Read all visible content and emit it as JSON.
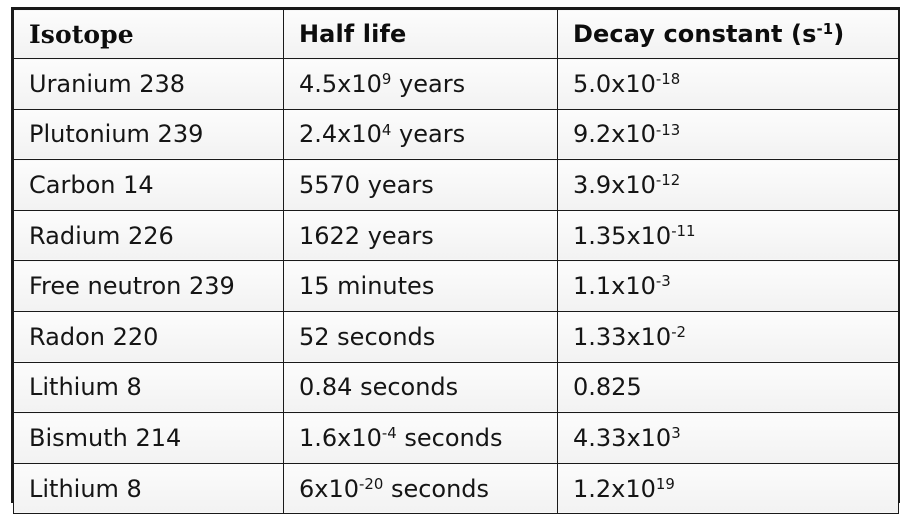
{
  "table": {
    "columns": [
      {
        "id": "isotope",
        "label": "Isotope"
      },
      {
        "id": "half_life",
        "label": "Half life"
      },
      {
        "id": "decay_constant",
        "label_base": "Decay constant (s",
        "label_sup": "-1",
        "label_tail": ")",
        "label_plain": "Decay constant (s-1)"
      }
    ],
    "rows": [
      {
        "isotope": "Uranium 238",
        "half_life": {
          "base": "4.5x10",
          "sup": "9",
          "tail": " years",
          "plain": "4.5x109 years"
        },
        "decay_constant": {
          "base": "5.0x10",
          "sup": "-18",
          "tail": "",
          "plain": "5.0x10-18"
        }
      },
      {
        "isotope": "Plutonium 239",
        "half_life": {
          "base": "2.4x10",
          "sup": "4",
          "tail": " years",
          "plain": "2.4x104 years"
        },
        "decay_constant": {
          "base": "9.2x10",
          "sup": "-13",
          "tail": "",
          "plain": "9.2x10-13"
        }
      },
      {
        "isotope": "Carbon 14",
        "half_life": {
          "base": "5570 years",
          "sup": "",
          "tail": "",
          "plain": "5570 years"
        },
        "decay_constant": {
          "base": "3.9x10",
          "sup": "-12",
          "tail": "",
          "plain": "3.9x10-12"
        }
      },
      {
        "isotope": "Radium 226",
        "half_life": {
          "base": "1622 years",
          "sup": "",
          "tail": "",
          "plain": "1622 years"
        },
        "decay_constant": {
          "base": "1.35x10",
          "sup": "-11",
          "tail": "",
          "plain": "1.35x10-11"
        }
      },
      {
        "isotope": "Free neutron 239",
        "half_life": {
          "base": "15 minutes",
          "sup": "",
          "tail": "",
          "plain": "15 minutes"
        },
        "decay_constant": {
          "base": "1.1x10",
          "sup": "-3",
          "tail": "",
          "plain": "1.1x10-3"
        }
      },
      {
        "isotope": "Radon 220",
        "half_life": {
          "base": "52 seconds",
          "sup": "",
          "tail": "",
          "plain": "52 seconds"
        },
        "decay_constant": {
          "base": "1.33x10",
          "sup": "-2",
          "tail": "",
          "plain": "1.33x10-2"
        }
      },
      {
        "isotope": "Lithium 8",
        "half_life": {
          "base": "0.84 seconds",
          "sup": "",
          "tail": "",
          "plain": "0.84 seconds"
        },
        "decay_constant": {
          "base": "0.825",
          "sup": "",
          "tail": "",
          "plain": "0.825"
        }
      },
      {
        "isotope": "Bismuth 214",
        "half_life": {
          "base": "1.6x10",
          "sup": "-4",
          "tail": " seconds",
          "plain": "1.6x10-4 seconds"
        },
        "decay_constant": {
          "base": "4.33x10",
          "sup": "3",
          "tail": "",
          "plain": "4.33x103"
        }
      },
      {
        "isotope": "Lithium 8",
        "half_life": {
          "base": "6x10",
          "sup": "-20",
          "tail": " seconds",
          "plain": "6x10-20 seconds"
        },
        "decay_constant": {
          "base": "1.2x10",
          "sup": "19",
          "tail": "",
          "plain": "1.2x1019"
        }
      }
    ]
  },
  "style": {
    "border_color": "#1a1a1a",
    "cell_background": "#f7f7f7",
    "text_color": "#151515",
    "page_background": "#ffffff"
  }
}
